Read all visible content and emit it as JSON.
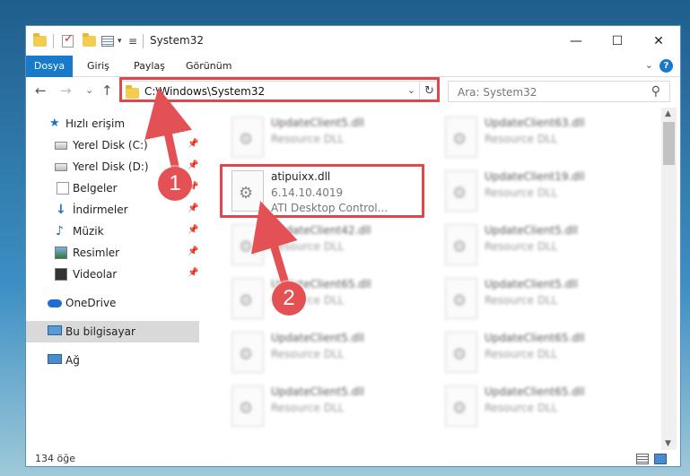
{
  "window": {
    "title": "System32",
    "controls": {
      "minimize": "—",
      "maximize": "☐",
      "close": "✕"
    }
  },
  "ribbon": {
    "tabs": [
      {
        "label": "Dosya"
      },
      {
        "label": "Giriş"
      },
      {
        "label": "Paylaş"
      },
      {
        "label": "Görünüm"
      }
    ],
    "help_label": "?",
    "collapse_glyph": "⌄"
  },
  "nav": {
    "back": "←",
    "forward": "→",
    "recent": "⌄",
    "up": "↑",
    "address": "C:\\Windows\\System32",
    "address_dropdown": "⌄",
    "refresh": "↻",
    "search_placeholder": "Ara: System32",
    "search_icon": "⚲"
  },
  "sidebar": {
    "items": [
      {
        "label": "Hızlı erişim",
        "icon": "star-icon"
      },
      {
        "label": "Yerel Disk (C:)",
        "icon": "disk-icon",
        "pinned": true
      },
      {
        "label": "Yerel Disk (D:)",
        "icon": "disk-icon",
        "pinned": true
      },
      {
        "label": "Belgeler",
        "icon": "document-icon",
        "pinned": true
      },
      {
        "label": "İndirmeler",
        "icon": "download-icon",
        "pinned": true
      },
      {
        "label": "Müzik",
        "icon": "music-icon",
        "pinned": true
      },
      {
        "label": "Resimler",
        "icon": "pictures-icon",
        "pinned": true
      },
      {
        "label": "Videolar",
        "icon": "videos-icon",
        "pinned": true
      },
      {
        "label": "OneDrive",
        "icon": "cloud-icon"
      },
      {
        "label": "Bu bilgisayar",
        "icon": "computer-icon",
        "selected": true
      },
      {
        "label": "Ağ",
        "icon": "network-icon"
      }
    ],
    "pin_glyph": "📌"
  },
  "files": {
    "highlighted": {
      "name": "atipuixx.dll",
      "version": "6.14.10.4019",
      "description": "ATI Desktop Control..."
    },
    "left_column": [
      {
        "name": "UpdateClient5.dll",
        "type": "Resource DLL"
      },
      {
        "name": "UpdateClient42.dll",
        "type": "Resource DLL"
      },
      {
        "name": "UpdateClient65.dll",
        "type": "Resource DLL"
      },
      {
        "name": "UpdateClient5.dll",
        "type": "Resource DLL"
      },
      {
        "name": "UpdateClient5.dll",
        "type": "Resource DLL"
      }
    ],
    "right_column": [
      {
        "name": "UpdateClient63.dll",
        "type": "Resource DLL"
      },
      {
        "name": "UpdateClient19.dll",
        "type": "Resource DLL"
      },
      {
        "name": "UpdateClient5.dll",
        "type": "Resource DLL"
      },
      {
        "name": "UpdateClient5.dll",
        "type": "Resource DLL"
      },
      {
        "name": "UpdateClient65.dll",
        "type": "Resource DLL"
      },
      {
        "name": "UpdateClient65.dll",
        "type": "Resource DLL"
      }
    ]
  },
  "status": {
    "count_text": "134 öğe"
  },
  "annotations": {
    "step1": "1",
    "step2": "2",
    "highlight_color": "#e0474c"
  }
}
